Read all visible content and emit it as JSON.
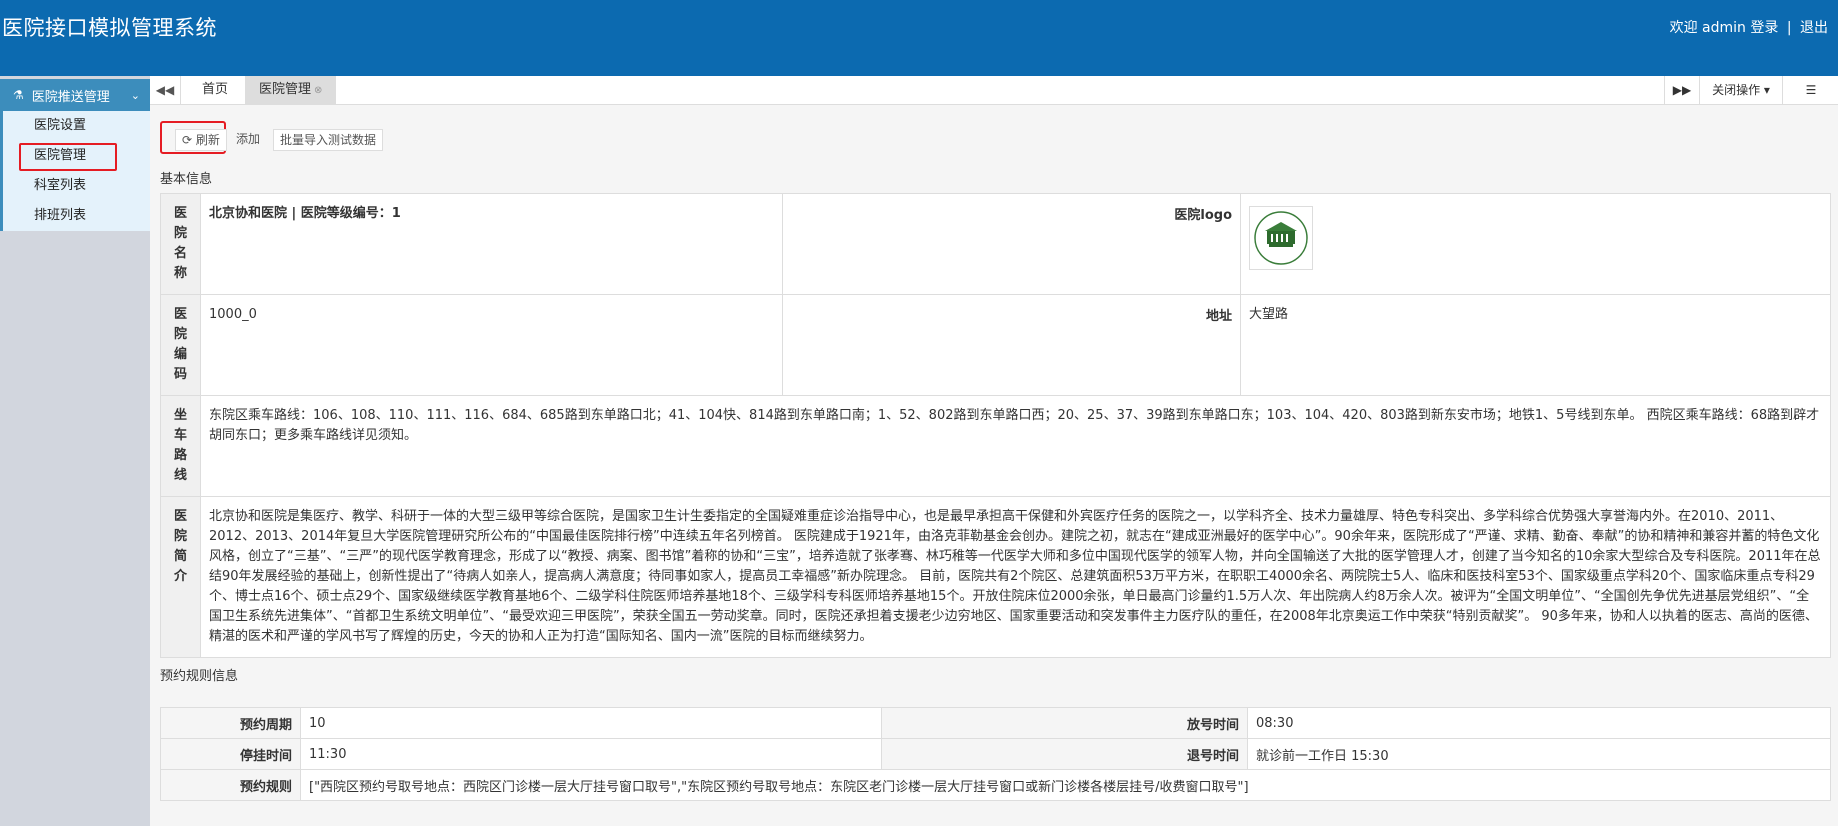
{
  "app": {
    "title": "医院接口模拟管理系统",
    "user_text": "欢迎 admin 登录",
    "logout": "退出",
    "sep": "|"
  },
  "sidebar": {
    "group_label": "医院推送管理",
    "items": [
      {
        "label": "医院设置"
      },
      {
        "label": "医院管理"
      },
      {
        "label": "科室列表"
      },
      {
        "label": "排班列表"
      }
    ]
  },
  "tabs": {
    "prev": "◀◀",
    "home": "首页",
    "active": "医院管理",
    "next": "▶▶",
    "close_ops": "关闭操作",
    "menu": "☰"
  },
  "toolbar": {
    "refresh": "刷新",
    "add": "添加",
    "batch_import": "批量导入测试数据"
  },
  "basic_info": {
    "title": "基本信息",
    "name_label": "医院名称",
    "name_value": "北京协和医院 | 医院等级编号：1",
    "logo_label": "医院logo",
    "code_label": "医院编码",
    "code_value": "1000_0",
    "address_label": "地址",
    "address_value": "大望路",
    "route_label": "坐车路线",
    "route_value": "东院区乘车路线：106、108、110、111、116、684、685路到东单路口北；41、104快、814路到东单路口南；1、52、802路到东单路口西；20、25、37、39路到东单路口东；103、104、420、803路到新东安市场；地铁1、5号线到东单。 西院区乘车路线：68路到辟才胡同东口；更多乘车路线详见须知。",
    "intro_label": "医院简介",
    "intro_value": "北京协和医院是集医疗、教学、科研于一体的大型三级甲等综合医院，是国家卫生计生委指定的全国疑难重症诊治指导中心，也是最早承担高干保健和外宾医疗任务的医院之一，以学科齐全、技术力量雄厚、特色专科突出、多学科综合优势强大享誉海内外。在2010、2011、2012、2013、2014年复旦大学医院管理研究所公布的“中国最佳医院排行榜”中连续五年名列榜首。 医院建成于1921年，由洛克菲勒基金会创办。建院之初，就志在“建成亚洲最好的医学中心”。90余年来，医院形成了“严谨、求精、勤奋、奉献”的协和精神和兼容并蓄的特色文化风格，创立了“三基”、“三严”的现代医学教育理念，形成了以“教授、病案、图书馆”着称的协和“三宝”，培养造就了张孝骞、林巧稚等一代医学大师和多位中国现代医学的领军人物，并向全国输送了大批的医学管理人才，创建了当今知名的10余家大型综合及专科医院。2011年在总结90年发展经验的基础上，创新性提出了“待病人如亲人，提高病人满意度；待同事如家人，提高员工幸福感”新办院理念。 目前，医院共有2个院区、总建筑面积53万平方米，在职职工4000余名、两院院士5人、临床和医技科室53个、国家级重点学科20个、国家临床重点专科29个、博士点16个、硕士点29个、国家级继续医学教育基地6个、二级学科住院医师培养基地18个、三级学科专科医师培养基地15个。开放住院床位2000余张，单日最高门诊量约1.5万人次、年出院病人约8万余人次。被评为“全国文明单位”、“全国创先争优先进基层党组织”、“全国卫生系统先进集体”、“首都卫生系统文明单位”、“最受欢迎三甲医院”，荣获全国五一劳动奖章。同时，医院还承担着支援老少边穷地区、国家重要活动和突发事件主力医疗队的重任，在2008年北京奥运工作中荣获“特别贡献奖”。 90多年来，协和人以执着的医志、高尚的医德、精湛的医术和严谨的学风书写了辉煌的历史，今天的协和人正为打造“国际知名、国内一流”医院的目标而继续努力。"
  },
  "booking_rules": {
    "title": "预约规则信息",
    "cycle_label": "预约周期",
    "cycle_value": "10",
    "release_label": "放号时间",
    "release_value": "08:30",
    "stop_label": "停挂时间",
    "stop_value": "11:30",
    "quit_label": "退号时间",
    "quit_value": "就诊前一工作日 15:30",
    "rule_label": "预约规则",
    "rule_value": "[\"西院区预约号取号地点：西院区门诊楼一层大厅挂号窗口取号\",\"东院区预约号取号地点：东院区老门诊楼一层大厅挂号窗口或新门诊楼各楼层挂号/收费窗口取号\"]"
  }
}
